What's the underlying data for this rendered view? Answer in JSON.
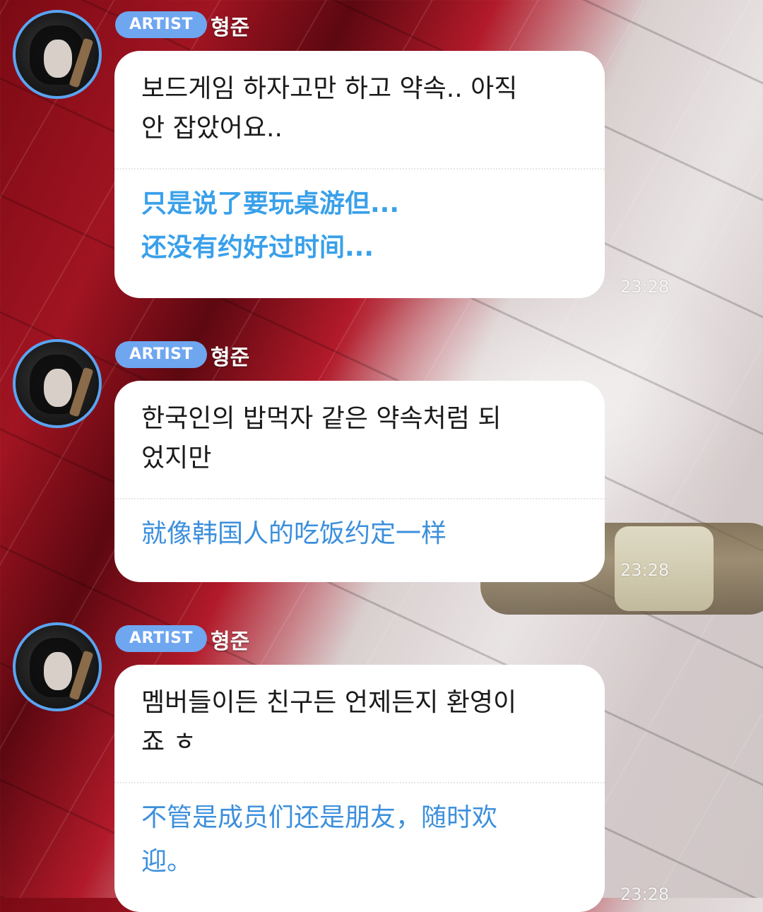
{
  "messages": [
    {
      "badge": "ARTIST",
      "name": "형준",
      "text_lines": [
        "보드게임 하자고만 하고 약속.. 아직",
        "안 잡았어요.."
      ],
      "translation_lines": [
        "只是说了要玩桌游但...",
        "还没有约好过时间..."
      ],
      "time": "23:28"
    },
    {
      "badge": "ARTIST",
      "name": "형준",
      "text_lines": [
        "한국인의 밥먹자 같은 약속처럼 되",
        "었지만"
      ],
      "translation_lines": [
        "就像韩国人的吃饭约定一样"
      ],
      "time": "23:28"
    },
    {
      "badge": "ARTIST",
      "name": "형준",
      "text_lines": [
        "멤버들이든 친구든 언제든지 환영이",
        "죠 ㅎ"
      ],
      "translation_lines": [
        "不管是成员们还是朋友，随时欢",
        "迎。"
      ],
      "time": "23:28"
    }
  ],
  "colors": {
    "badge": "#6fa6f0",
    "avatar_ring": "#5aa4f2",
    "translation_text": "#3c8fdc",
    "bubble": "#ffffff"
  },
  "icons": {
    "avatar": "profile-avatar"
  }
}
